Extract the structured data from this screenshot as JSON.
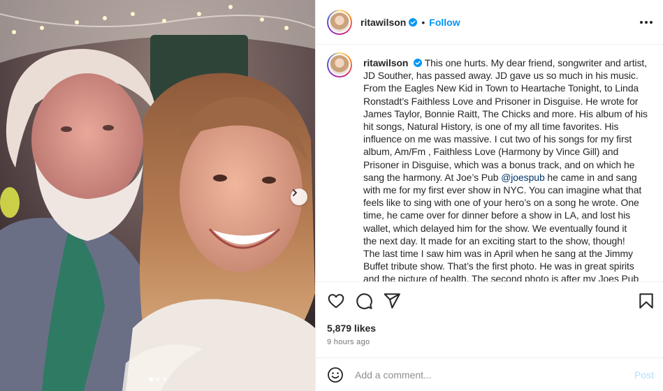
{
  "post": {
    "username": "ritawilson",
    "follow_label": "Follow",
    "separator": "•"
  },
  "caption": {
    "username": "ritawilson",
    "text_before_mention": "This one hurts. My dear friend, songwriter and artist,\nJD Souther, has passed away. JD gave us so much in his music.\nFrom the Eagles New Kid in Town to Heartache Tonight, to Linda\nRonstadt’s Faithless Love and Prisoner in Disguise. He wrote for\nJames Taylor, Bonnie Raitt, The Chicks and more. His album of his\nhit songs, Natural History, is one of my all time favorites. His\ninfluence on me was massive. I cut two of his songs for my first\nalbum, Am/Fm , Faithless Love (Harmony by Vince Gill) and\nPrisoner in Disguise, which was a bonus track, and on which he\nsang the harmony. At Joe’s Pub ",
    "mention": "@joespub",
    "text_after_mention": " he came in and sang\nwith me for my first ever show in NYC. You can imagine what that\nfeels like to sing with one of your hero’s on a song he wrote. One\ntime, he came over for dinner before a show in LA, and lost his\nwallet, which delayed him for the show. We eventually found it\nthe next day. It made for an exciting start to the show, though!\nThe last time I saw him was in April when he sang at the Jimmy\nBuffet tribute show. That’s the first photo. He was in great spirits\nand the picture of health. The second photo is after my Joes Pub"
  },
  "engagement": {
    "likes": "5,879 likes",
    "timestamp": "9 hours ago"
  },
  "comment": {
    "placeholder": "Add a comment...",
    "post_label": "Post"
  },
  "carousel": {
    "slide_count": 3,
    "active_index": 0
  },
  "colors": {
    "accent_blue": "#0095f6",
    "verified_blue": "#0095f6",
    "post_disabled": "#b2dffc",
    "border": "#efefef"
  },
  "icons": [
    "verified-icon",
    "more-icon",
    "heart-icon",
    "comment-icon",
    "share-icon",
    "bookmark-icon",
    "emoji-icon",
    "chevron-right-icon"
  ]
}
